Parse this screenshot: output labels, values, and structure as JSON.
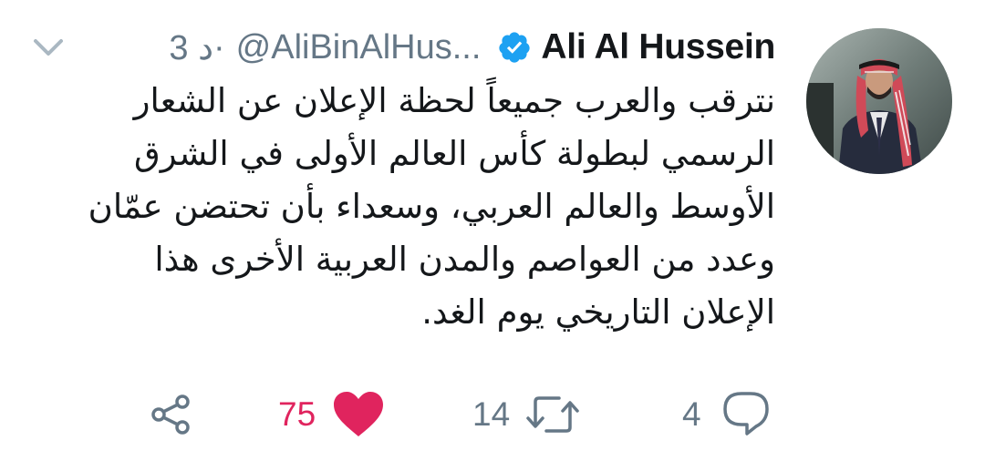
{
  "tweet": {
    "author_name": "Ali Al Hussein",
    "verified_icon": "verified-badge-icon",
    "handle": "@AliBinAlHus...",
    "separator": "·",
    "time": "3 د",
    "text": "نترقب والعرب جميعاً لحظة الإعلان عن الشعار الرسمي لبطولة كأس العالم الأولى في الشرق الأوسط والعالم العربي، وسعداء بأن تحتضن عمّان وعدد من العواصم والمدن العربية الأخرى هذا الإعلان التاريخي يوم الغد.",
    "avatar_icon": "profile-photo"
  },
  "actions": {
    "reply": {
      "icon": "reply-icon",
      "count": "4"
    },
    "retweet": {
      "icon": "retweet-icon",
      "count": "14"
    },
    "like": {
      "icon": "heart-icon",
      "count": "75",
      "color": "#e0245e"
    },
    "share": {
      "icon": "share-icon"
    }
  },
  "colors": {
    "verified_blue": "#1da1f2",
    "secondary_text": "#657786",
    "like_red": "#e0245e"
  }
}
